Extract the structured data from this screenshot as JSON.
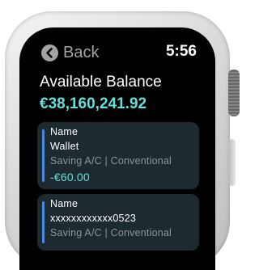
{
  "status_bar": {
    "back_label": "Back",
    "time": "5:56"
  },
  "summary": {
    "heading": "Available Balance",
    "balance": "€38,160,241.92"
  },
  "accounts": [
    {
      "title": "Name",
      "name": "Wallet",
      "type": "Saving A/C | Conventional",
      "amount": "-€60.00"
    },
    {
      "title": "Name",
      "number": "xxxxxxxxxxxx0523",
      "type": "Saving A/C | Conventional"
    }
  ],
  "colors": {
    "accent_teal": "#63e0d9",
    "card_bg": "#1d2a30",
    "card_stripe": "#3d8bf5",
    "muted_text": "#8b969b"
  },
  "icons": {
    "back": "chevron-left-circle"
  }
}
